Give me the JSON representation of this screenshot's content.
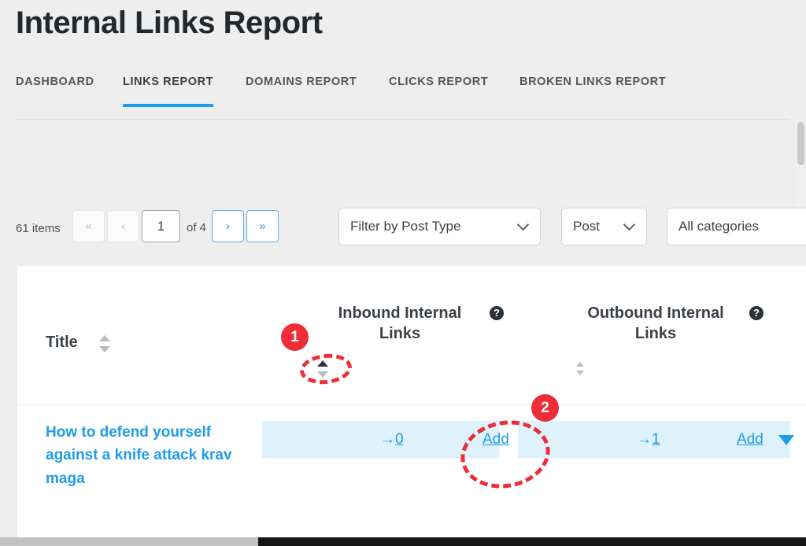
{
  "page": {
    "title": "Internal Links Report",
    "accent_color": "#1e9ceb",
    "annotation_color": "#ee2d37",
    "highlight_color": "#ddf2fb"
  },
  "tabs": [
    {
      "label": "DASHBOARD",
      "active": false
    },
    {
      "label": "LINKS REPORT",
      "active": true
    },
    {
      "label": "DOMAINS REPORT",
      "active": false
    },
    {
      "label": "CLICKS REPORT",
      "active": false
    },
    {
      "label": "BROKEN LINKS REPORT",
      "active": false
    }
  ],
  "toolbar": {
    "items_count": "61 items",
    "first_page_label": "«",
    "prev_page_label": "‹",
    "page_value": "1",
    "page_total_label": "of 4",
    "next_page_label": "›",
    "last_page_label": "»",
    "post_type_filter": {
      "value": "Filter by Post Type",
      "icon": "chevron-down-icon"
    },
    "post_select": {
      "value": "Post",
      "icon": "chevron-down-icon"
    },
    "category_select": {
      "value": "All categories",
      "icon": "chevron-down-icon"
    }
  },
  "table": {
    "headers": {
      "title": "Title",
      "inbound_line1": "Inbound Internal",
      "inbound_line2": "Links",
      "outbound_line1": "Outbound Internal",
      "outbound_line2": "Links",
      "help_glyph": "?"
    },
    "rows": [
      {
        "title": "How to defend yourself against a knife attack krav maga",
        "inbound": {
          "arrow": "→",
          "count": "0",
          "add_label": "Add"
        },
        "outbound": {
          "arrow": "→",
          "count": "1",
          "add_label": "Add"
        }
      }
    ]
  },
  "annotations": [
    {
      "number": "1",
      "target": "inbound-sort-ascending-control"
    },
    {
      "number": "2",
      "target": "inbound-add-dropdown"
    }
  ]
}
